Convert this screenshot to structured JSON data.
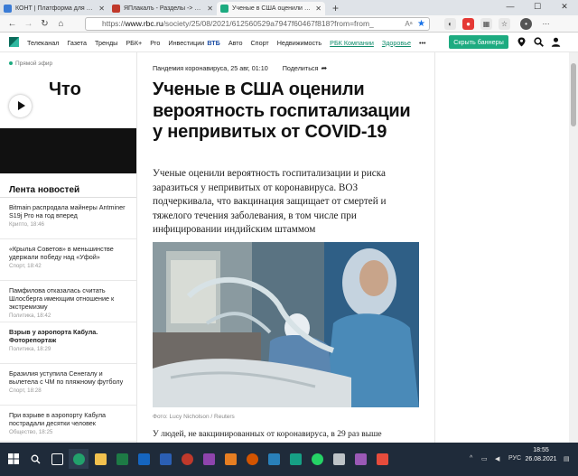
{
  "browser": {
    "tabs": [
      {
        "label": "КОНТ | Платформа для социальн",
        "favicon_color": "#3a7bd5",
        "active": false
      },
      {
        "label": "ЯПлакалъ - Разделы -> Цитирую",
        "favicon_color": "#c0392b",
        "active": false
      },
      {
        "label": "Ученые в США оценили вероятн",
        "favicon_color": "#1dab80",
        "active": true
      }
    ],
    "new_tab": "+",
    "url_prefix": "https://",
    "url_domain": "www.rbc.ru",
    "url_rest": "/society/25/08/2021/612560529a7947f60467f818?from=from_"
  },
  "site": {
    "nav": [
      {
        "label": "Телеканал",
        "style": "normal"
      },
      {
        "label": "Газета",
        "style": "normal"
      },
      {
        "label": "Тренды",
        "style": "normal"
      },
      {
        "label": "РБК+",
        "style": "normal"
      },
      {
        "label": "Pro",
        "style": "normal"
      },
      {
        "label": "Инвестиции",
        "style": "normal"
      },
      {
        "label": "ВТБ",
        "style": "vtb"
      },
      {
        "label": "Авто",
        "style": "normal"
      },
      {
        "label": "Спорт",
        "style": "normal"
      },
      {
        "label": "Недвижимость",
        "style": "normal"
      },
      {
        "label": "РБК Компании",
        "style": "hl"
      },
      {
        "label": "Здоровье",
        "style": "hl"
      }
    ],
    "more": "•••",
    "subscribe_button": "Скрыть баннеры",
    "accent": "#1dab80"
  },
  "live": {
    "tag": "Прямой эфир",
    "word": "Что"
  },
  "feed": {
    "title": "Лента новостей",
    "items": [
      {
        "text": "Bitmain распродала майнеры Antminer S19j Pro на год вперед",
        "meta": "Крипто, 18:46",
        "bold": false
      },
      {
        "text": "«Крылья Советов» в меньшинстве удержали победу над «Уфой»",
        "meta": "Спорт, 18:42",
        "bold": false
      },
      {
        "text": "Памфилова отказалась считать Шлосберга имеющим отношение к экстремизму",
        "meta": "Политика, 18:42",
        "bold": false
      },
      {
        "text": "Взрыв у аэропорта Кабула. Фоторепортаж",
        "meta": "Политика, 18:29",
        "bold": true
      },
      {
        "text": "Бразилия уступила Сенегалу и вылетела с ЧМ по пляжному футболу",
        "meta": "Спорт, 18:28",
        "bold": false
      },
      {
        "text": "При взрыве в аэропорту Кабула пострадали десятки человек",
        "meta": "Общество, 18:25",
        "bold": false
      }
    ]
  },
  "article": {
    "rubric_date": "Пандемия коронавируса, 25 авг, 01:10",
    "share": "Поделиться",
    "headline": "Ученые в США оценили вероятность госпитализации у непривитых от COVID-19",
    "lead": "Ученые оценили вероятность госпитализации и риска заразиться у непривитых от коронавируса. ВОЗ подчеркивала, что вакцинация защищает от смертей и тяжелого течения заболевания, в том числе при инфицировании индийским штаммом",
    "photo_caption": "Фото: Lucy Nicholson / Reuters",
    "body_start": "У людей, не вакцинированных от коронавируса, в 29 раз выше"
  },
  "taskbar": {
    "search_placeholder": "",
    "tray_lang": "РУС",
    "time": "18:55",
    "date": "26.08.2021"
  }
}
